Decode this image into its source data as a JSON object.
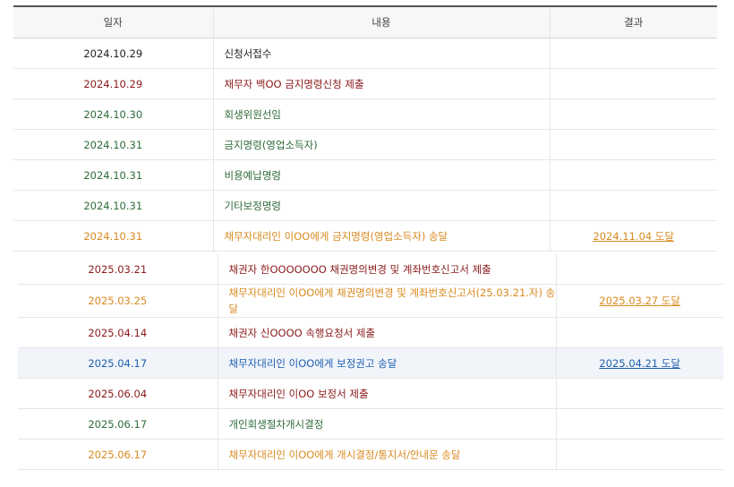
{
  "header": {
    "date": "일자",
    "content": "내용",
    "result": "결과"
  },
  "colors": {
    "black": "#222222",
    "red": "#8b1a1a",
    "green": "#2f6b3a",
    "orange": "#d98a1f",
    "blue": "#1f5fb0"
  },
  "group1": [
    {
      "date": "2024.10.29",
      "content": "신청서접수",
      "result": "",
      "color": "black"
    },
    {
      "date": "2024.10.29",
      "content": "채무자 백OO 금지명령신청 제출",
      "result": "",
      "color": "red"
    },
    {
      "date": "2024.10.30",
      "content": "회생위원선임",
      "result": "",
      "color": "green"
    },
    {
      "date": "2024.10.31",
      "content": "금지명령(영업소득자)",
      "result": "",
      "color": "green"
    },
    {
      "date": "2024.10.31",
      "content": "비용예납명령",
      "result": "",
      "color": "green"
    },
    {
      "date": "2024.10.31",
      "content": "기타보정명령",
      "result": "",
      "color": "green"
    },
    {
      "date": "2024.10.31",
      "content": "채무자대리인 이OO에게 금지명령(영업소득자) 송달",
      "result": "2024.11.04 도달",
      "color": "orange"
    }
  ],
  "group2": [
    {
      "date": "2025.03.21",
      "content": "채권자 한OOOOOOO 채권명의변경 및 계좌번호신고서 제출",
      "result": "",
      "color": "red"
    },
    {
      "date": "2025.03.25",
      "content": "채무자대리인 이OO에게 채권명의변경 및 계좌번호신고서(25.03.21.자) 송달",
      "result": "2025.03.27 도달",
      "color": "orange"
    },
    {
      "date": "2025.04.14",
      "content": "채권자 신OOOO 속행요청서 제출",
      "result": "",
      "color": "red"
    },
    {
      "date": "2025.04.17",
      "content": "채무자대리인 이OO에게 보정권고 송달",
      "result": "2025.04.21 도달",
      "color": "blue",
      "highlight": true
    },
    {
      "date": "2025.06.04",
      "content": "채무자대리인 이OO 보정서 제출",
      "result": "",
      "color": "red"
    },
    {
      "date": "2025.06.17",
      "content": "개인회생절차개시결정",
      "result": "",
      "color": "green"
    },
    {
      "date": "2025.06.17",
      "content": "채무자대리인 이OO에게 개시결정/통지서/안내문 송달",
      "result": "",
      "color": "orange"
    }
  ]
}
